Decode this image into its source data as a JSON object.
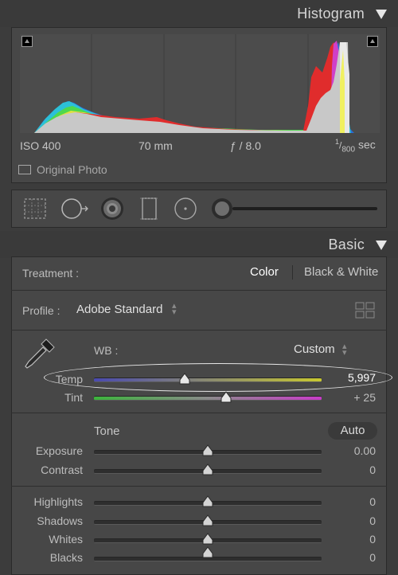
{
  "histogram": {
    "title": "Histogram",
    "info": {
      "iso": "ISO 400",
      "focal": "70 mm",
      "aperture": "ƒ / 8.0",
      "shutter_num": "1",
      "shutter_den": "800",
      "shutter_unit": "sec"
    },
    "original_photo_label": "Original Photo"
  },
  "tools": {
    "icons": [
      "crop-overlay-icon",
      "spot-removal-icon",
      "red-eye-icon",
      "graduated-filter-icon",
      "radial-filter-icon",
      "adjustment-brush-icon"
    ]
  },
  "basic": {
    "title": "Basic",
    "treatment": {
      "label": "Treatment :",
      "color": "Color",
      "bw": "Black & White"
    },
    "profile": {
      "label": "Profile :",
      "value": "Adobe Standard"
    },
    "wb": {
      "label": "WB :",
      "value": "Custom"
    },
    "temp": {
      "label": "Temp",
      "value": "5,997",
      "position": 0.4
    },
    "tint": {
      "label": "Tint",
      "value": "+ 25",
      "position": 0.58
    },
    "tone_label": "Tone",
    "auto_label": "Auto",
    "sliders": [
      {
        "label": "Exposure",
        "value": "0.00",
        "position": 0.5
      },
      {
        "label": "Contrast",
        "value": "0",
        "position": 0.5
      },
      {
        "label": "Highlights",
        "value": "0",
        "position": 0.5
      },
      {
        "label": "Shadows",
        "value": "0",
        "position": 0.5
      },
      {
        "label": "Whites",
        "value": "0",
        "position": 0.5
      },
      {
        "label": "Blacks",
        "value": "0",
        "position": 0.5
      }
    ]
  },
  "colors": {
    "panel_bg": "#3c3c3c",
    "box_bg": "#4a4a4a",
    "highlight_text": "#ffffff",
    "temp_gradient_start": "#4a4ab0",
    "temp_gradient_end": "#c8c830",
    "tint_gradient_start": "#3cb43c",
    "tint_gradient_end": "#c83cc8"
  }
}
